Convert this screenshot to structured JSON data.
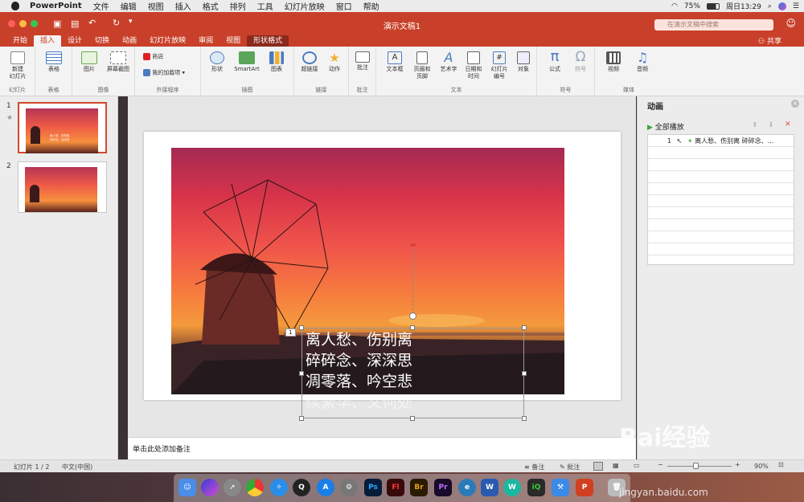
{
  "menubar": {
    "app_name": "PowerPoint",
    "items": [
      "文件",
      "编辑",
      "视图",
      "插入",
      "格式",
      "排列",
      "工具",
      "幻灯片放映",
      "窗口",
      "帮助"
    ],
    "battery": "75%",
    "clock": "周日13:29"
  },
  "window": {
    "title": "演示文稿1",
    "search_placeholder": "在演示文稿中搜索",
    "share_label": "共享"
  },
  "tabs": [
    "开始",
    "插入",
    "设计",
    "切换",
    "动画",
    "幻灯片放映",
    "审阅",
    "视图",
    "形状格式"
  ],
  "active_tab": "插入",
  "ribbon": {
    "new_slide": "新建\n幻灯片",
    "slides_group": "幻灯片",
    "table": "表格",
    "table_group": "表格",
    "picture": "图片",
    "screenshot": "屏幕截图",
    "image_group": "图像",
    "store": "商店",
    "my_addins": "我的加载项",
    "addins_group": "外接程序",
    "shapes": "形状",
    "smartart": "SmartArt",
    "chart": "图表",
    "illustrations_group": "插图",
    "hyperlink": "超链接",
    "action": "动作",
    "links_group": "链接",
    "comment": "批注",
    "comment_group": "批注",
    "textbox": "文本框",
    "header_footer": "页眉和\n页脚",
    "wordart": "艺术字",
    "date_time": "日期和\n时间",
    "slide_number": "幻灯片\n编号",
    "object": "对象",
    "text_group": "文本",
    "equation": "公式",
    "symbol": "符号",
    "symbols_group": "符号",
    "video": "视频",
    "audio": "音频",
    "media_group": "媒体"
  },
  "slides": [
    {
      "number": "1",
      "star": "★",
      "thumb_text": "离人愁、伤别离\n碎碎念、深深思"
    },
    {
      "number": "2"
    }
  ],
  "slide": {
    "text_lines": [
      "离人愁、伤别离",
      "碎碎念、深深思",
      "凋零落、吟空悲",
      "续繁华、又何处"
    ],
    "anim_tag": "1"
  },
  "notes_placeholder": "单击此处添加备注",
  "animation_pane": {
    "title": "动画",
    "play_all": "全部播放",
    "items": [
      {
        "index": "1",
        "label": "离人愁、伤别离 碎碎念、..."
      }
    ]
  },
  "statusbar": {
    "slide_info": "幻灯片 1 / 2",
    "language": "中文(中国)",
    "notes": "备注",
    "comments": "批注",
    "zoom": "90%"
  },
  "dock": [
    "Ps",
    "Fl",
    "Br",
    "Pr",
    "W",
    "P"
  ],
  "watermark": {
    "brand": "Bai经验",
    "url": "jingyan.baidu.com"
  },
  "colors": {
    "accent": "#c9402a",
    "selection": "#d04a2c"
  }
}
